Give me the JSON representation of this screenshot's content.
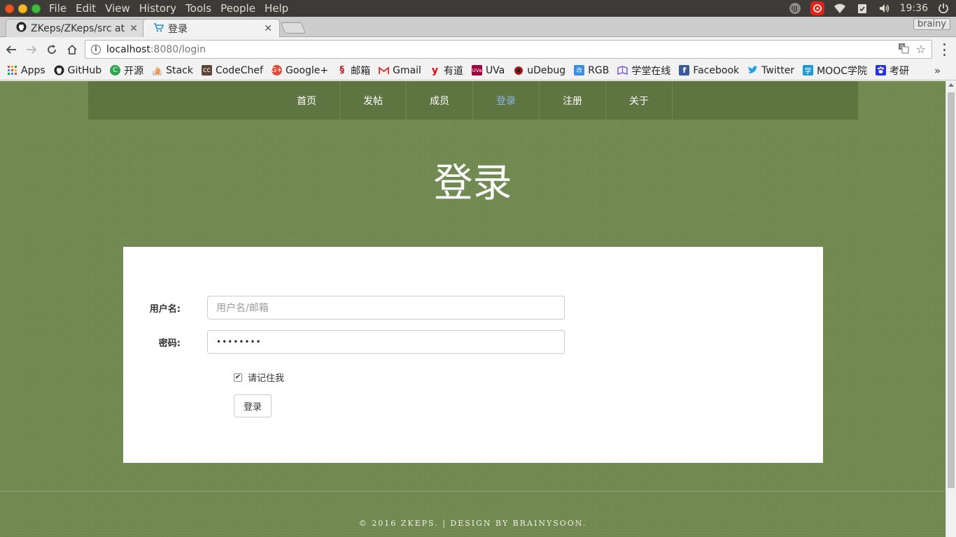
{
  "os": {
    "menu": [
      "File",
      "Edit",
      "View",
      "History",
      "Tools",
      "People",
      "Help"
    ],
    "time": "19:36",
    "netease_icon": "netease-music-icon"
  },
  "tabs": [
    {
      "title": "ZKeps/ZKeps/src at m",
      "icon": "github-icon"
    },
    {
      "title": "登录",
      "icon": "cart-icon"
    }
  ],
  "profile_name": "brainy",
  "address": {
    "host": "localhost",
    "rest": ":8080/login"
  },
  "bookmarks": [
    {
      "label": "Apps",
      "icon": "apps-grid-icon",
      "color": "#e04b2f"
    },
    {
      "label": "GitHub",
      "icon": "github-icon",
      "color": "#222222"
    },
    {
      "label": "开源",
      "icon": "oschina-icon",
      "color": "#2ea44f"
    },
    {
      "label": "Stack",
      "icon": "stackoverflow-icon",
      "color": "#f48024"
    },
    {
      "label": "CodeChef",
      "icon": "codechef-icon",
      "color": "#5b4638"
    },
    {
      "label": "Google+",
      "icon": "googleplus-icon",
      "color": "#dd4b39"
    },
    {
      "label": "邮箱",
      "icon": "mail-163-icon",
      "color": "#c4161c"
    },
    {
      "label": "Gmail",
      "icon": "gmail-icon",
      "color": "#d93025"
    },
    {
      "label": "有道",
      "icon": "youdao-icon",
      "color": "#e60012"
    },
    {
      "label": "UVa",
      "icon": "uva-icon",
      "color": "#a0003c"
    },
    {
      "label": "uDebug",
      "icon": "udebug-icon",
      "color": "#b01818"
    },
    {
      "label": "RGB",
      "icon": "rgb-icon",
      "color": "#3a8ee6"
    },
    {
      "label": "学堂在线",
      "icon": "xuetang-icon",
      "color": "#7b5bd6"
    },
    {
      "label": "Facebook",
      "icon": "facebook-icon",
      "color": "#3b5998"
    },
    {
      "label": "Twitter",
      "icon": "twitter-icon",
      "color": "#1da1f2"
    },
    {
      "label": "MOOC学院",
      "icon": "mooc-icon",
      "color": "#1a9ad6"
    },
    {
      "label": "考研",
      "icon": "baidu-paw-icon",
      "color": "#2932e1"
    }
  ],
  "site": {
    "nav": [
      "首页",
      "发帖",
      "成员",
      "登录",
      "注册",
      "关于"
    ],
    "current_nav": "登录",
    "title": "登录",
    "form": {
      "username_label": "用户名:",
      "username_placeholder": "用户名/邮箱",
      "password_label": "密码:",
      "password_value": "••••••••",
      "remember_label": "请记住我",
      "remember_checked": true,
      "submit_label": "登录"
    },
    "footer": "© 2016 ZKEPS. | DESIGN BY BRAINYSOON."
  },
  "colors": {
    "page_bg": "#718a50",
    "nav_bg": "#5f7541",
    "active_link": "#8fb3e6"
  }
}
